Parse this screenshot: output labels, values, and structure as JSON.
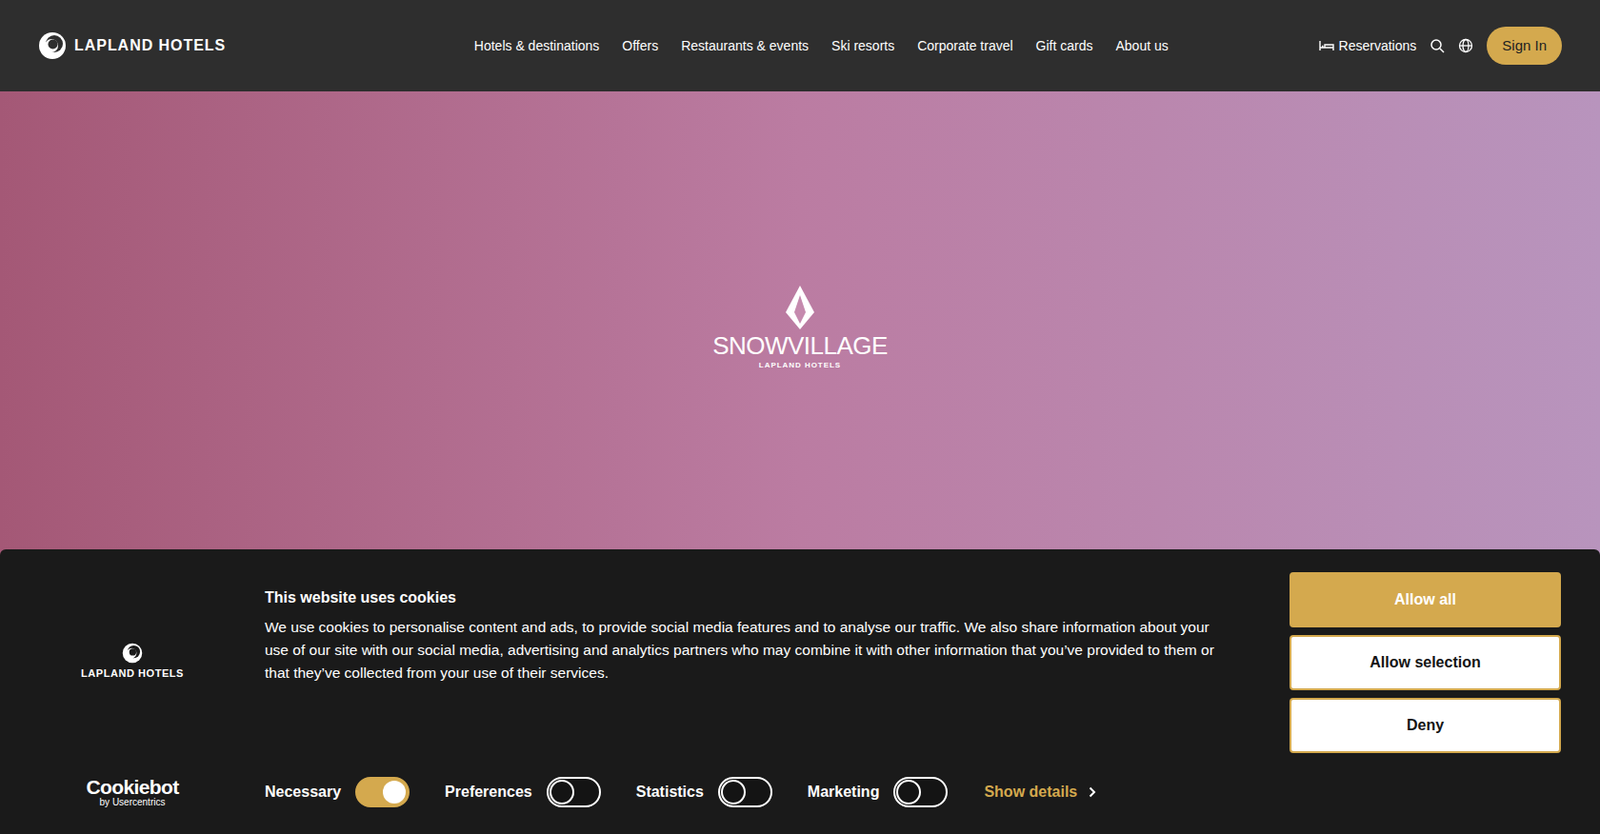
{
  "header": {
    "logo": "LAPLAND HOTELS",
    "nav": [
      "Hotels & destinations",
      "Offers",
      "Restaurants & events",
      "Ski resorts",
      "Corporate travel",
      "Gift cards",
      "About us"
    ],
    "reservations": "Reservations",
    "sign_in": "Sign In"
  },
  "hero": {
    "logo_title": "SNOWVILLAGE",
    "logo_sub": "LAPLAND HOTELS"
  },
  "cookie": {
    "logo": "LAPLAND HOTELS",
    "title": "This website uses cookies",
    "body": "We use cookies to personalise content and ads, to provide social media features and to analyse our traffic. We also share information about your use of our site with our social media, advertising and analytics partners who may combine it with other information that you’ve provided to them or that they’ve collected from your use of their services.",
    "buttons": [
      {
        "label": "Allow all",
        "kind": "primary"
      },
      {
        "label": "Allow selection",
        "kind": "secondary"
      },
      {
        "label": "Deny",
        "kind": "secondary"
      }
    ],
    "toggles": [
      {
        "label": "Necessary",
        "on": true
      },
      {
        "label": "Preferences",
        "on": false
      },
      {
        "label": "Statistics",
        "on": false
      },
      {
        "label": "Marketing",
        "on": false
      }
    ],
    "show_details": "Show details",
    "cookiebot": "Cookiebot",
    "cookiebot_sub": "by Usercentrics"
  }
}
